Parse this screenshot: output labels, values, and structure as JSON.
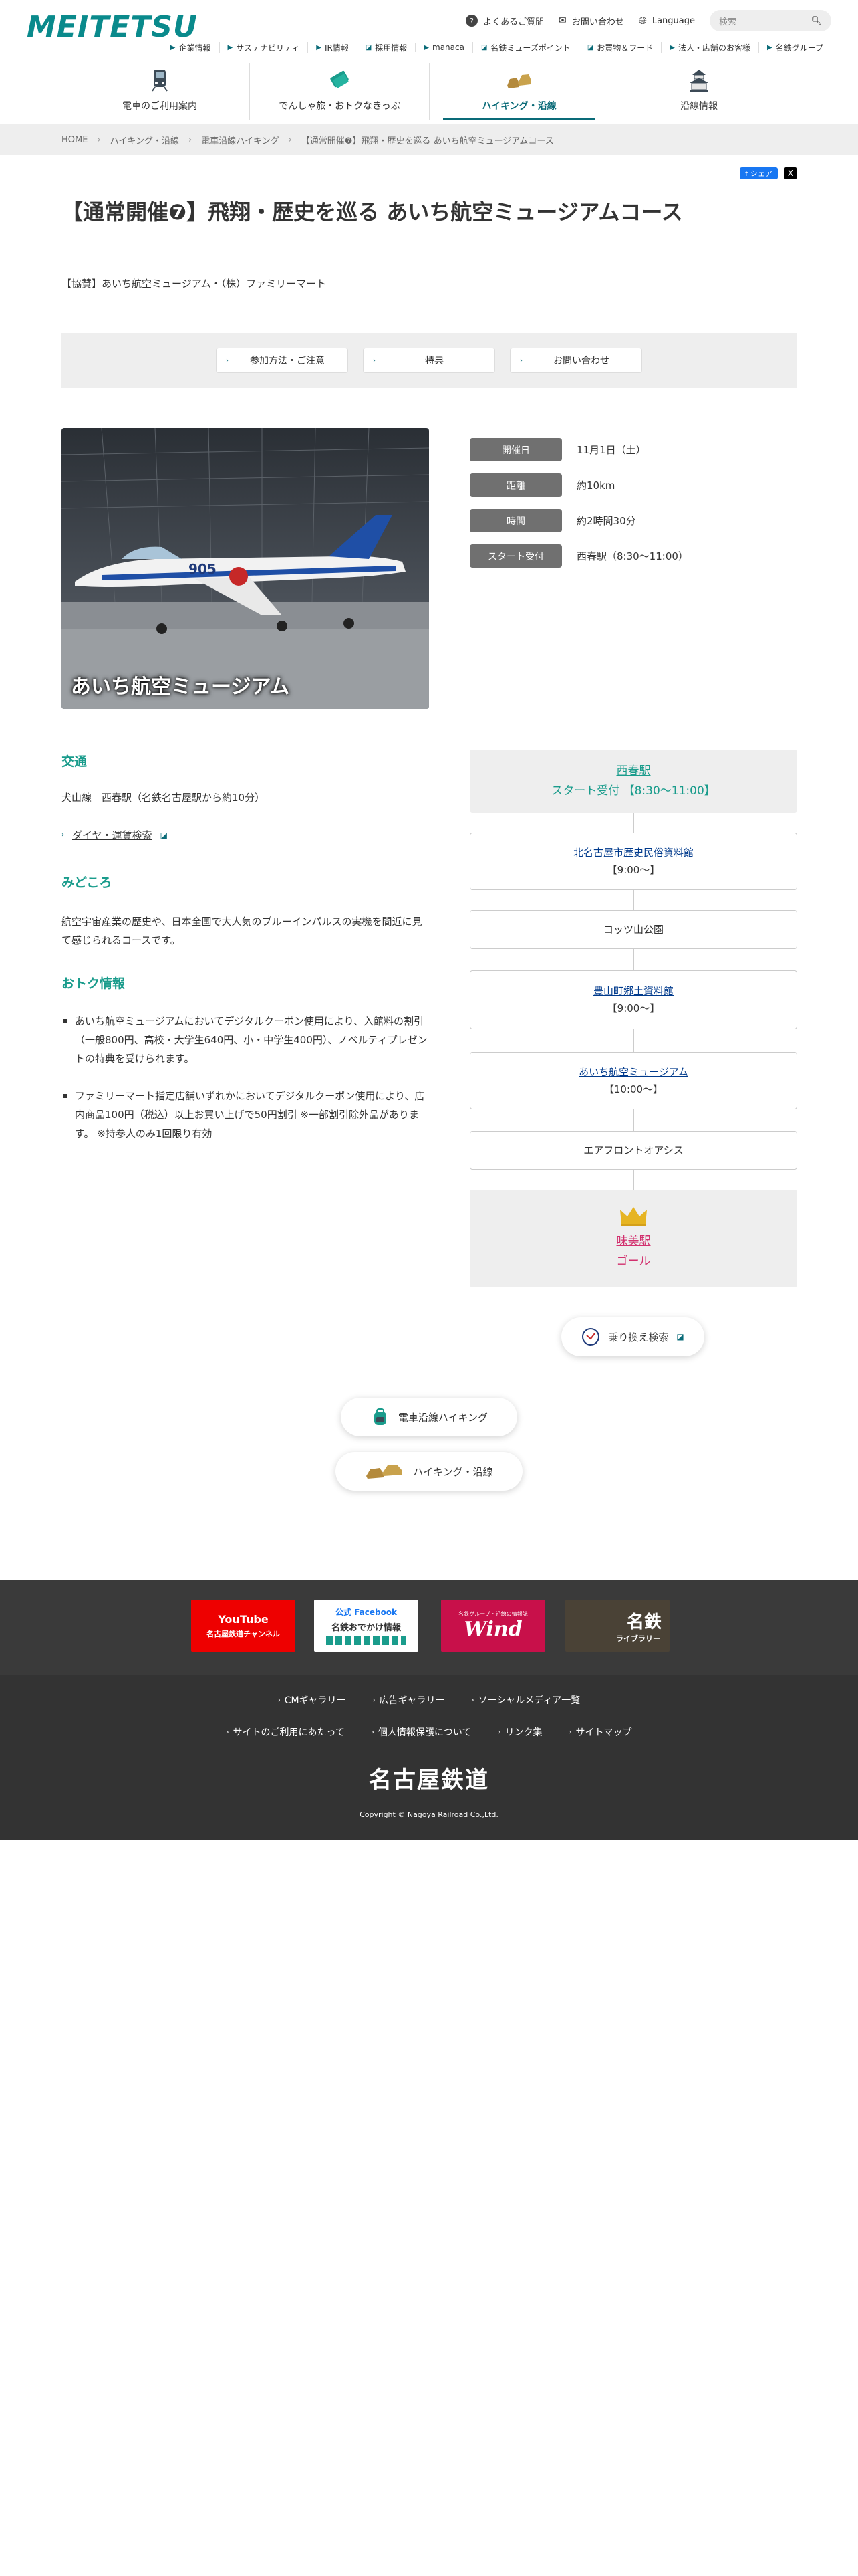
{
  "header": {
    "logo": "MEITETSU",
    "util": [
      {
        "label": "よくあるご質問",
        "icon": "question-icon"
      },
      {
        "label": "お問い合わせ",
        "icon": "mail-icon"
      },
      {
        "label": "Language",
        "icon": "globe-icon"
      }
    ],
    "search_placeholder": "検索",
    "subnav": [
      "企業情報",
      "サステナビリティ",
      "IR情報",
      "採用情報",
      "manaca",
      "名鉄ミューズポイント",
      "お買物＆フード",
      "法人・店舗のお客様",
      "名鉄グループ"
    ],
    "mainnav": [
      {
        "label": "電車のご利用案内",
        "icon": "train-icon"
      },
      {
        "label": "でんしゃ旅・おトクなきっぷ",
        "icon": "ticket-icon"
      },
      {
        "label": "ハイキング・沿線",
        "icon": "hiking-shoes-icon",
        "active": true
      },
      {
        "label": "沿線情報",
        "icon": "castle-icon"
      }
    ]
  },
  "breadcrumb": [
    "HOME",
    "ハイキング・沿線",
    "電車沿線ハイキング",
    "【通常開催❼】飛翔・歴史を巡る あいち航空ミュージアムコース"
  ],
  "share": {
    "facebook": "シェア",
    "x": "X"
  },
  "page_title": "【通常開催❼】飛翔・歴史を巡る あいち航空ミュージアムコース",
  "sponsor": "【協賛】あいち航空ミュージアム・（株）ファミリーマート",
  "tabs": [
    "参加方法・ご注意",
    "特典",
    "お問い合わせ"
  ],
  "photo_caption": "あいち航空ミュージアム",
  "info": [
    {
      "label": "開催日",
      "value": "11月1日（土）"
    },
    {
      "label": "距離",
      "value": "約10km"
    },
    {
      "label": "時間",
      "value": "約2時間30分"
    },
    {
      "label": "スタート受付",
      "value": "西春駅（8:30〜11:00）"
    }
  ],
  "access": {
    "heading": "交通",
    "text": "犬山線　西春駅（名鉄名古屋駅から約10分）",
    "link": "ダイヤ・運賃検索"
  },
  "midokoro": {
    "heading": "みどころ",
    "text": "航空宇宙産業の歴史や、日本全国で大人気のブルーインパルスの実機を間近に見て感じられるコースです。"
  },
  "otoku": {
    "heading": "おトク情報",
    "items": [
      "あいち航空ミュージアムにおいてデジタルクーポン使用により、入館料の割引（一般800円、高校・大学生640円、小・中学生400円）、ノベルティプレゼントの特典を受けられます。",
      "ファミリーマート指定店舗いずれかにおいてデジタルクーポン使用により、店内商品100円（税込）以上お買い上げで50円割引 ※一部割引除外品があります。 ※持参人のみ1回限り有効"
    ]
  },
  "course": {
    "start_station": "西春駅",
    "start_time": "スタート受付 【8:30〜11:00】",
    "stops": [
      {
        "name": "北名古屋市歴史民俗資料館",
        "time": "【9:00〜】",
        "link": true
      },
      {
        "name": "コッツ山公園",
        "time": "",
        "link": false
      },
      {
        "name": "豊山町郷土資料館",
        "time": "【9:00〜】",
        "link": true
      },
      {
        "name": "あいち航空ミュージアム",
        "time": "【10:00〜】",
        "link": true
      },
      {
        "name": "エアフロントオアシス",
        "time": "",
        "link": false
      }
    ],
    "goal_station": "味美駅",
    "goal_label": "ゴール",
    "transfer_button": "乗り換え検索"
  },
  "bottom_buttons": [
    "電車沿線ハイキング",
    "ハイキング・沿線"
  ],
  "footer": {
    "banners": [
      {
        "line1": "YouTube",
        "line2": "名古屋鉄道チャンネル"
      },
      {
        "line1": "公式 Facebook",
        "line2": "名鉄おでかけ情報"
      },
      {
        "line1": "Wind",
        "line2": "名鉄グループ・沿線の情報誌"
      },
      {
        "line1": "名鉄",
        "line2": "ライブラリー"
      }
    ],
    "links_row1": [
      "CMギャラリー",
      "広告ギャラリー",
      "ソーシャルメディア一覧"
    ],
    "links_row2": [
      "サイトのご利用にあたって",
      "個人情報保護について",
      "リンク集",
      "サイトマップ"
    ],
    "logo": "名古屋鉄道",
    "copyright": "Copyright © Nagoya Railroad Co.,Ltd."
  },
  "colors": {
    "accent": "#0a6b78",
    "teal_text": "#1a9c8c",
    "goal": "#d2306e",
    "footer": "#333333"
  }
}
